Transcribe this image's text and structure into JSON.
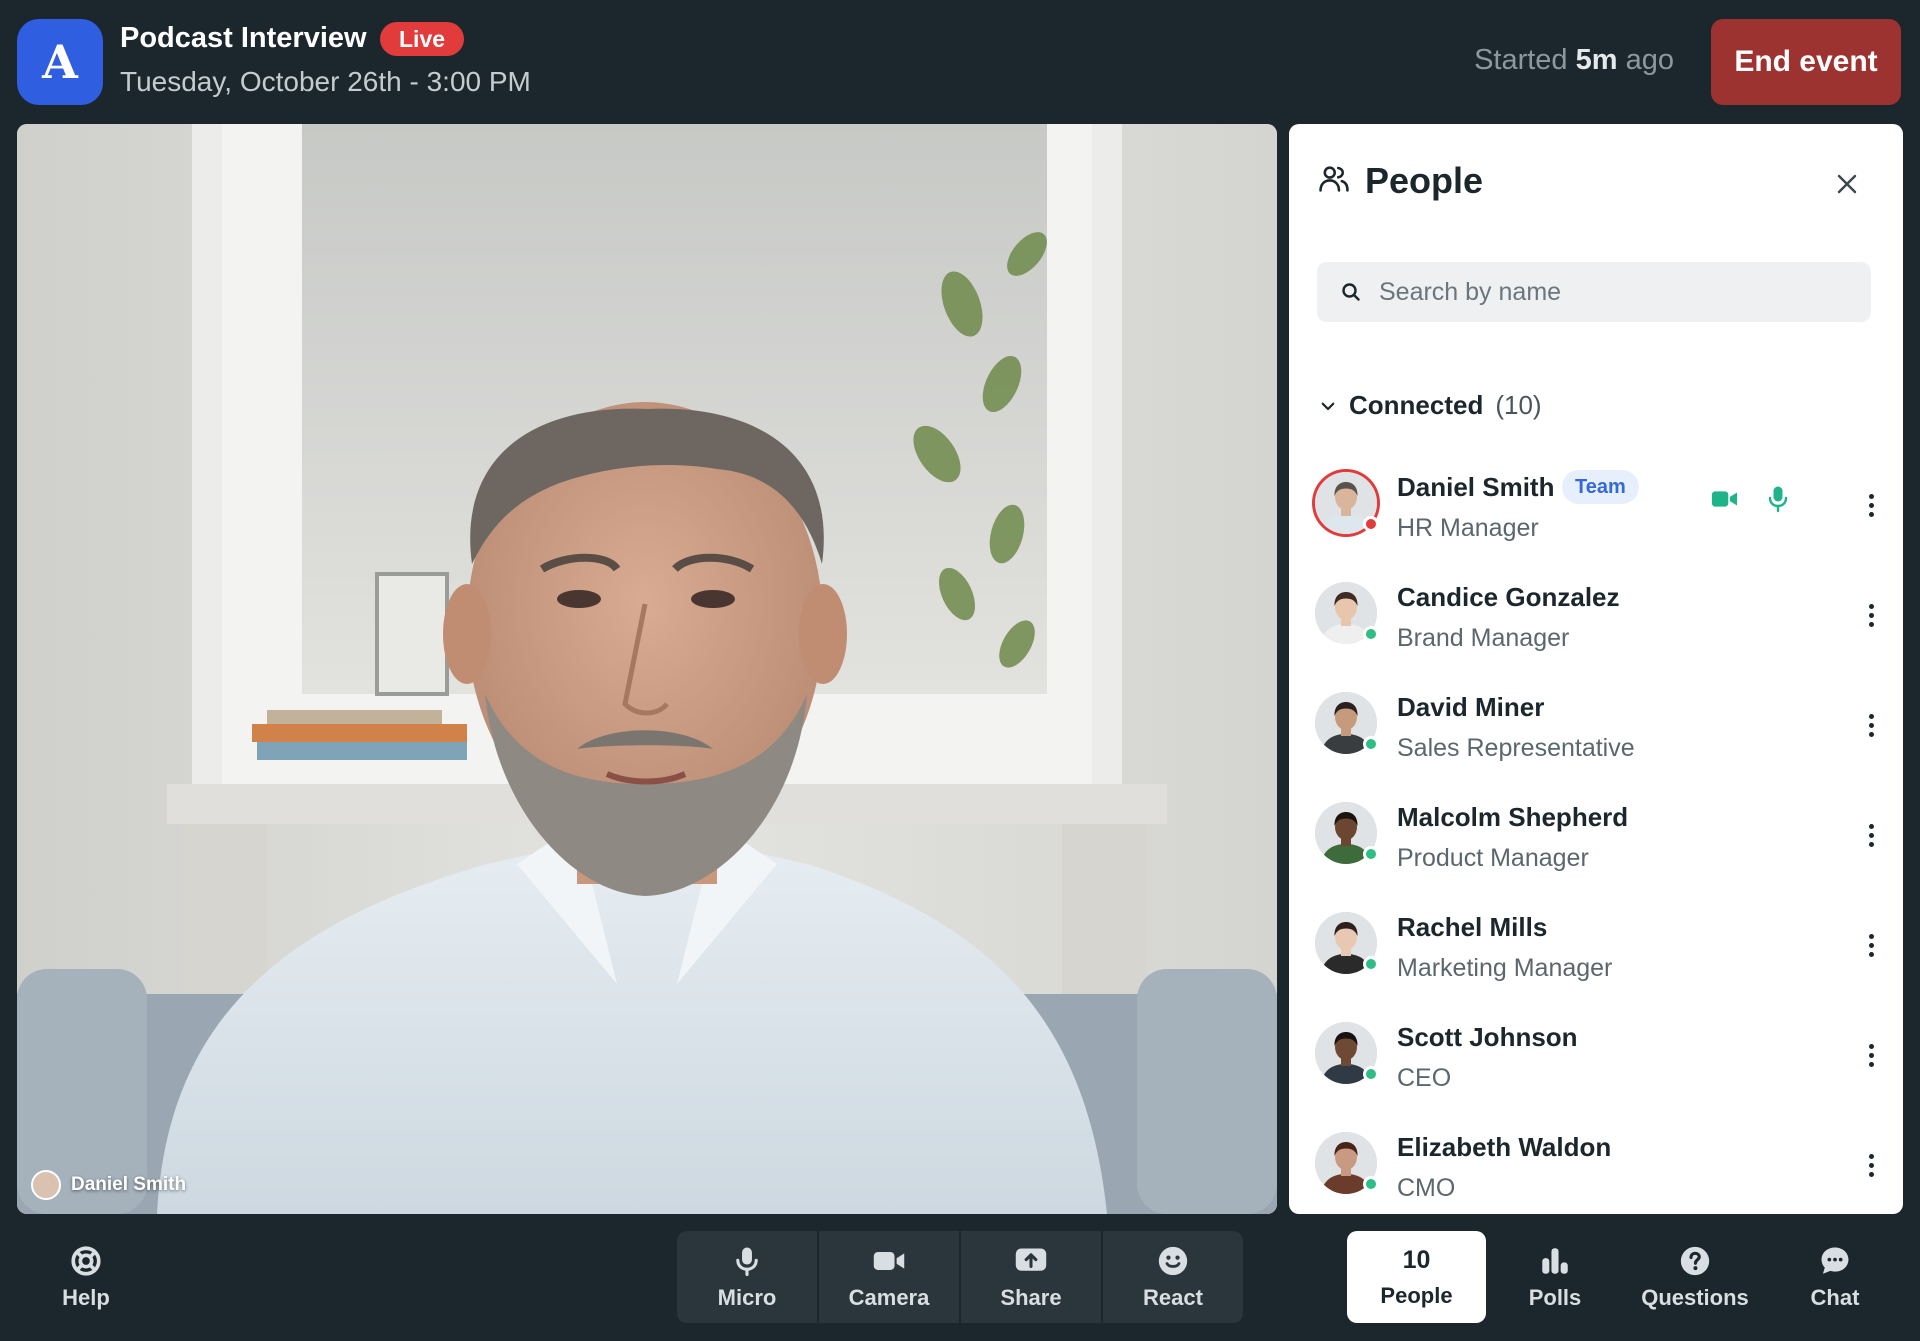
{
  "header": {
    "logo_letter": "A",
    "title": "Podcast Interview",
    "live_badge": "Live",
    "date": "Tuesday, October 26th - 3:00 PM",
    "started_prefix": "Started",
    "started_value": "5m",
    "started_suffix": "ago",
    "end_button": "End event"
  },
  "video": {
    "speaker_name": "Daniel Smith"
  },
  "people_panel": {
    "title": "People",
    "search_placeholder": "Search by name",
    "group_label": "Connected",
    "group_count": "(10)",
    "people": [
      {
        "name": "Daniel Smith",
        "role": "HR Manager",
        "badge": "Team",
        "status": "speaking",
        "skin": "#d9b59c",
        "hair": "#5a534d",
        "shirt": "#dfe7ee"
      },
      {
        "name": "Candice Gonzalez",
        "role": "Brand Manager",
        "status": "online",
        "skin": "#e7c6ad",
        "hair": "#3e2c22",
        "shirt": "#efefef"
      },
      {
        "name": "David Miner",
        "role": "Sales Representative",
        "status": "online",
        "skin": "#c69a7c",
        "hair": "#2a2220",
        "shirt": "#3a3d40"
      },
      {
        "name": "Malcolm Shepherd",
        "role": "Product Manager",
        "status": "online",
        "skin": "#6b4631",
        "hair": "#1c1411",
        "shirt": "#3d6b3c"
      },
      {
        "name": "Rachel Mills",
        "role": "Marketing Manager",
        "status": "online",
        "skin": "#e8c8b2",
        "hair": "#2e211a",
        "shirt": "#2a2a2a"
      },
      {
        "name": "Scott Johnson",
        "role": "CEO",
        "status": "online",
        "skin": "#6e4a35",
        "hair": "#1a1210",
        "shirt": "#2f3a44"
      },
      {
        "name": "Elizabeth Waldon",
        "role": "CMO",
        "status": "online",
        "skin": "#c99a82",
        "hair": "#4a2418",
        "shirt": "#6b3c2c"
      }
    ]
  },
  "toolbar": {
    "help": "Help",
    "micro": "Micro",
    "camera": "Camera",
    "share": "Share",
    "react": "React",
    "people_count": "10",
    "people": "People",
    "polls": "Polls",
    "questions": "Questions",
    "chat": "Chat"
  },
  "colors": {
    "background": "#1b272d",
    "accent_blue": "#2f5ee0",
    "live_red": "#e23b3b",
    "end_button": "#9c3331",
    "online_green": "#2ebd85",
    "media_green": "#1fb38a"
  }
}
